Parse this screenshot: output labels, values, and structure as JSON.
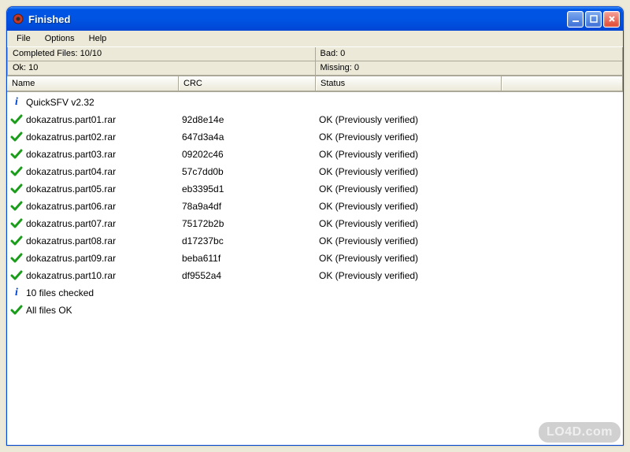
{
  "window": {
    "title": "Finished"
  },
  "menu": {
    "file": "File",
    "options": "Options",
    "help": "Help"
  },
  "info": {
    "completed": "Completed Files: 10/10",
    "bad": "Bad: 0",
    "ok": "Ok: 10",
    "missing": "Missing: 0"
  },
  "columns": {
    "name": "Name",
    "crc": "CRC",
    "status": "Status"
  },
  "rows": [
    {
      "icon": "info",
      "name": "QuickSFV v2.32",
      "crc": "",
      "status": ""
    },
    {
      "icon": "check",
      "name": "dokazatrus.part01.rar",
      "crc": "92d8e14e",
      "status": "OK (Previously verified)"
    },
    {
      "icon": "check",
      "name": "dokazatrus.part02.rar",
      "crc": "647d3a4a",
      "status": "OK (Previously verified)"
    },
    {
      "icon": "check",
      "name": "dokazatrus.part03.rar",
      "crc": "09202c46",
      "status": "OK (Previously verified)"
    },
    {
      "icon": "check",
      "name": "dokazatrus.part04.rar",
      "crc": "57c7dd0b",
      "status": "OK (Previously verified)"
    },
    {
      "icon": "check",
      "name": "dokazatrus.part05.rar",
      "crc": "eb3395d1",
      "status": "OK (Previously verified)"
    },
    {
      "icon": "check",
      "name": "dokazatrus.part06.rar",
      "crc": "78a9a4df",
      "status": "OK (Previously verified)"
    },
    {
      "icon": "check",
      "name": "dokazatrus.part07.rar",
      "crc": "75172b2b",
      "status": "OK (Previously verified)"
    },
    {
      "icon": "check",
      "name": "dokazatrus.part08.rar",
      "crc": "d17237bc",
      "status": "OK (Previously verified)"
    },
    {
      "icon": "check",
      "name": "dokazatrus.part09.rar",
      "crc": "beba611f",
      "status": "OK (Previously verified)"
    },
    {
      "icon": "check",
      "name": "dokazatrus.part10.rar",
      "crc": "df9552a4",
      "status": "OK (Previously verified)"
    },
    {
      "icon": "info",
      "name": "10 files checked",
      "crc": "",
      "status": ""
    },
    {
      "icon": "check",
      "name": "All files OK",
      "crc": "",
      "status": ""
    }
  ],
  "watermark": "LO4D.com"
}
